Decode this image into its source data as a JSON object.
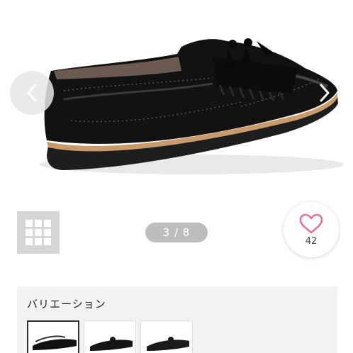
{
  "gallery": {
    "product_image": "black-tassel-loafer-side-view",
    "prev_icon": "chevron-left-icon",
    "next_icon": "chevron-right-icon",
    "page_indicator": "3 / 8"
  },
  "grid_button": {
    "icon": "grid-icon"
  },
  "favorite": {
    "icon": "heart-icon",
    "count": "42",
    "color": "#e46f8c"
  },
  "variations": {
    "title": "バリエーション",
    "items": [
      {
        "name": "variation-1",
        "selected": true
      },
      {
        "name": "variation-2",
        "selected": false
      },
      {
        "name": "variation-3",
        "selected": false
      }
    ]
  }
}
